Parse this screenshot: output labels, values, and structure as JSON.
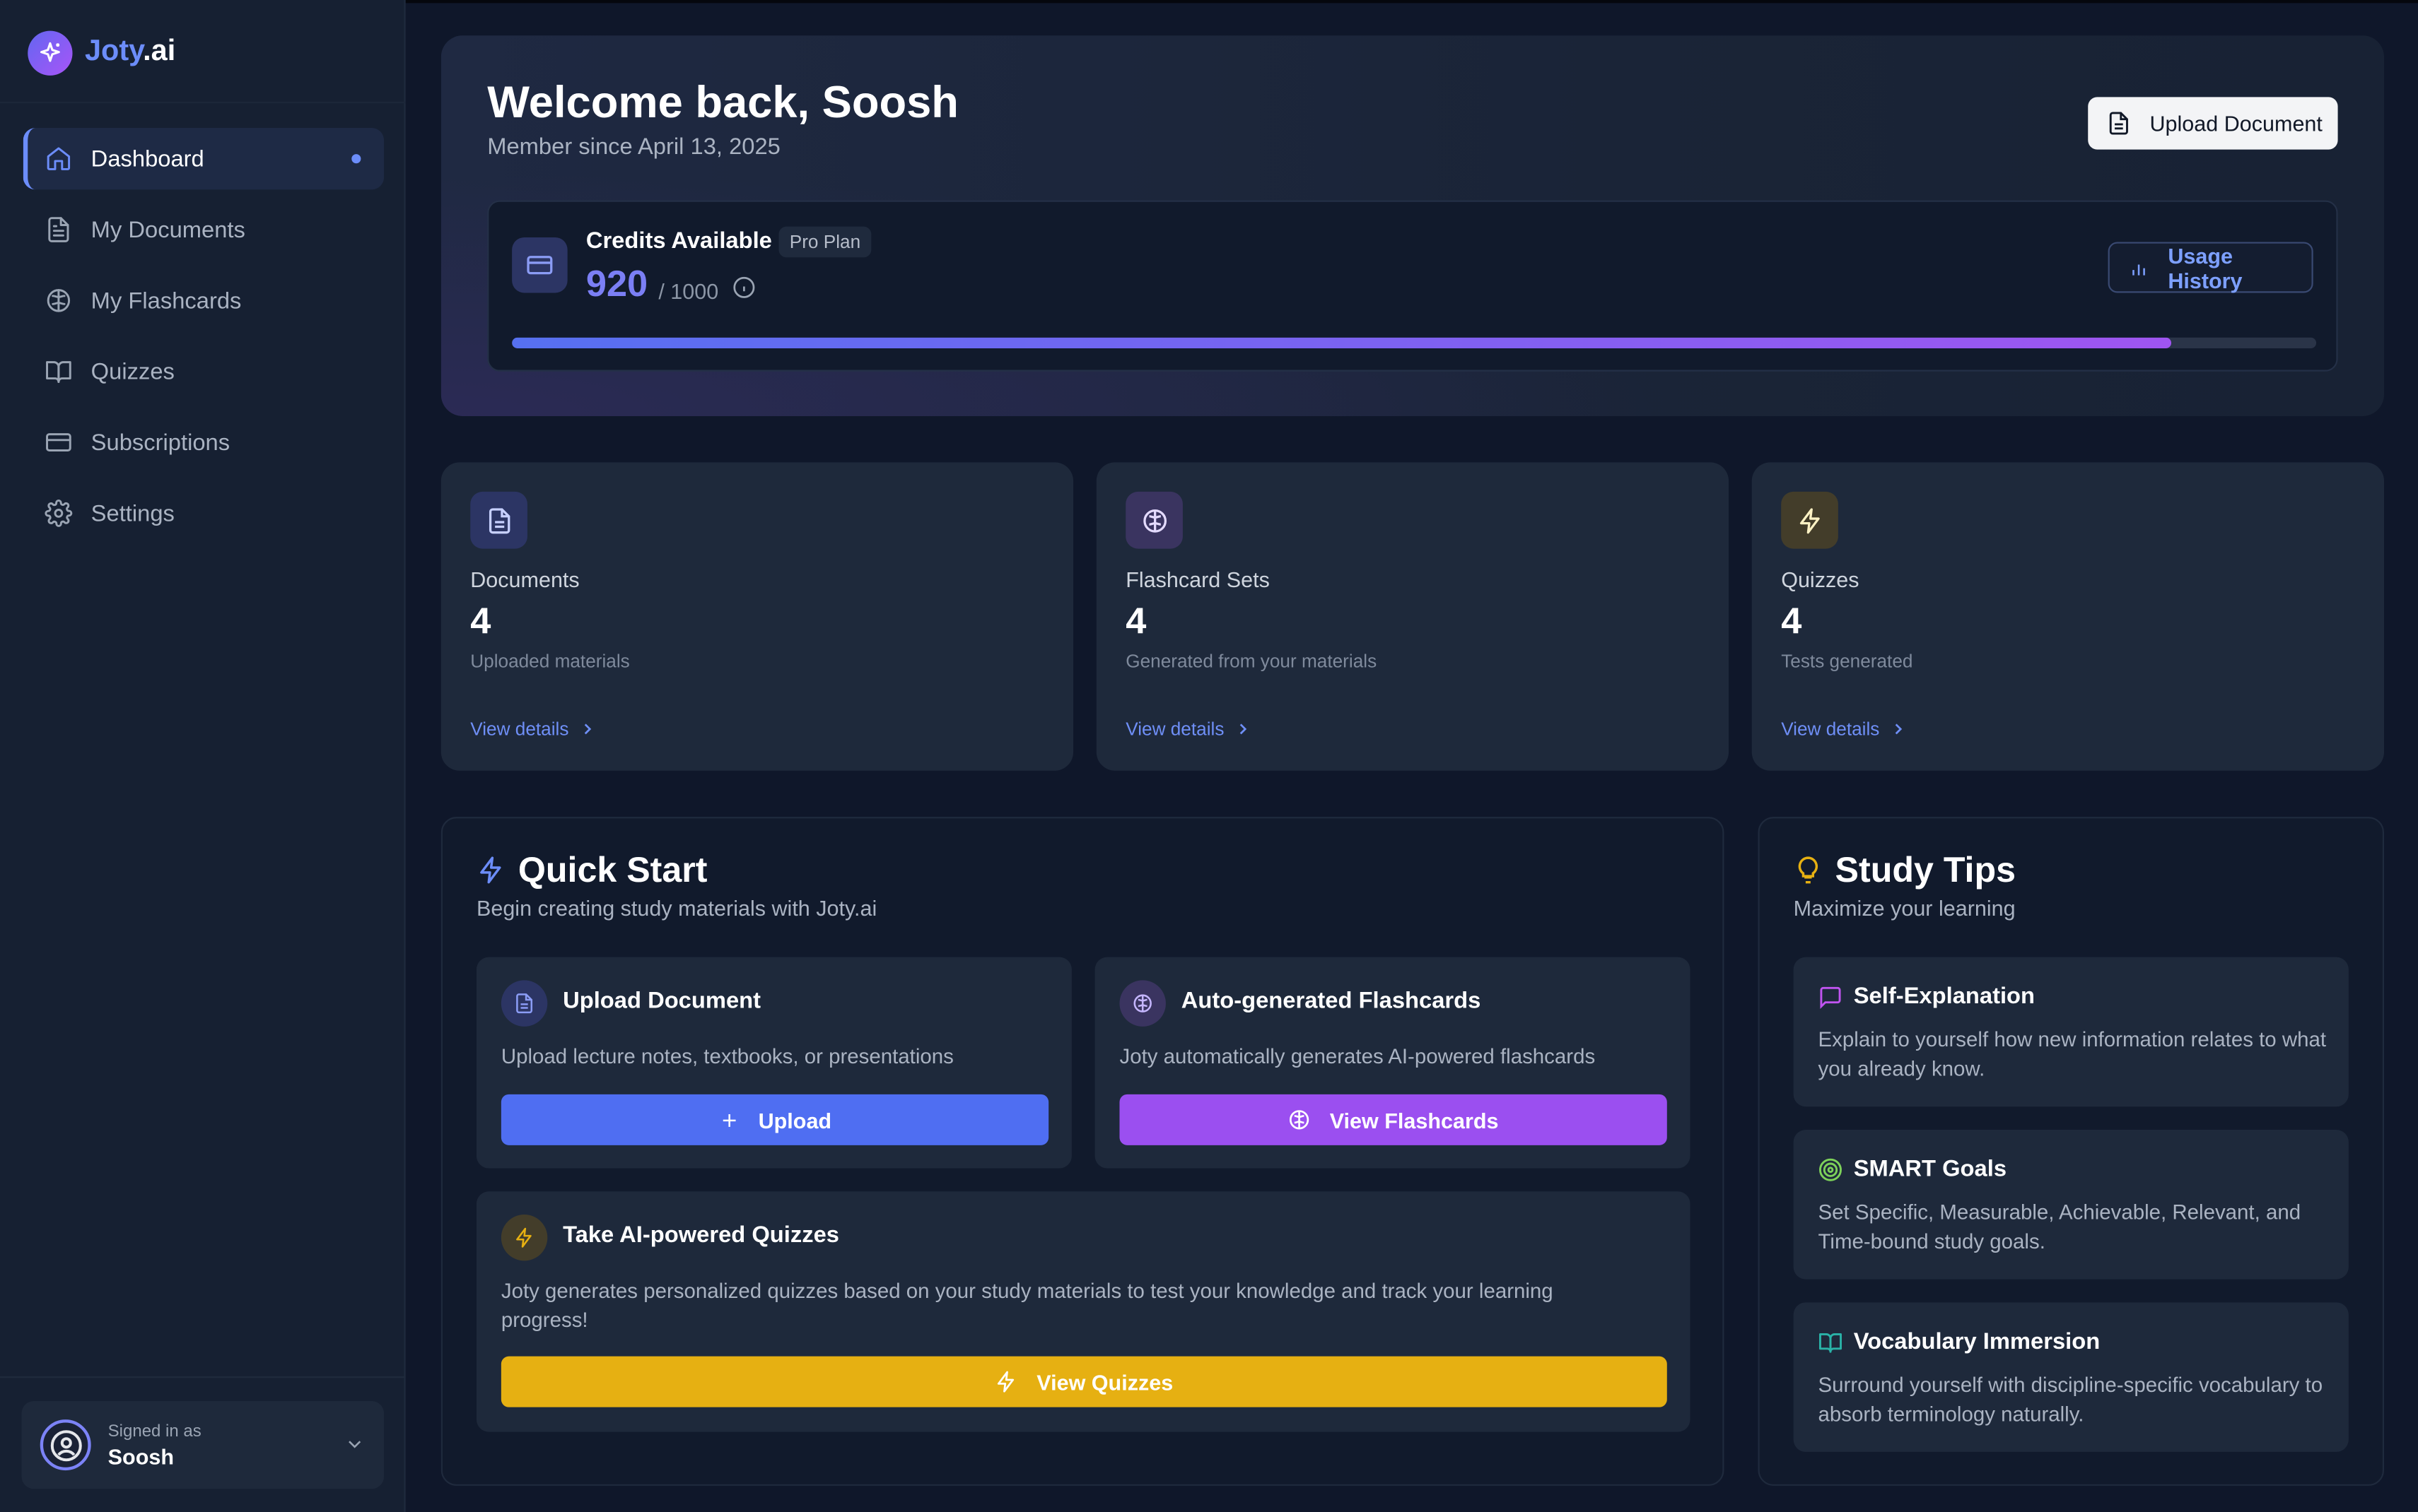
{
  "brand": {
    "name_part1": "Joty",
    "name_part2": ".ai",
    "accent_color": "#6c8dfa"
  },
  "sidebar": {
    "items": [
      {
        "label": "Dashboard",
        "icon": "home-icon",
        "active": true
      },
      {
        "label": "My Documents",
        "icon": "document-icon"
      },
      {
        "label": "My Flashcards",
        "icon": "brain-icon"
      },
      {
        "label": "Quizzes",
        "icon": "book-open-icon"
      },
      {
        "label": "Subscriptions",
        "icon": "credit-card-icon"
      },
      {
        "label": "Settings",
        "icon": "gear-icon"
      }
    ],
    "user": {
      "signed_in_label": "Signed in as",
      "name": "Soosh"
    }
  },
  "welcome": {
    "title": "Welcome back, Soosh",
    "member_since": "Member since April 13, 2025",
    "upload_button": "Upload Document"
  },
  "credits": {
    "title": "Credits Available",
    "plan": "Pro Plan",
    "available": "920",
    "total_text": "/ 1000",
    "used_fraction": 0.92,
    "usage_button": "Usage History"
  },
  "stats": [
    {
      "label": "Documents",
      "value": "4",
      "desc": "Uploaded materials",
      "link": "View details",
      "icon": "document-icon",
      "color": "#8b9cf5"
    },
    {
      "label": "Flashcard Sets",
      "value": "4",
      "desc": "Generated from your materials",
      "link": "View details",
      "icon": "brain-icon",
      "color": "#c4b5fd"
    },
    {
      "label": "Quizzes",
      "value": "4",
      "desc": "Tests generated",
      "link": "View details",
      "icon": "lightning-icon",
      "color": "#fde68a"
    }
  ],
  "quick_start": {
    "title": "Quick Start",
    "subtitle": "Begin creating study materials with Joty.ai",
    "upload": {
      "title": "Upload Document",
      "desc": "Upload lecture notes, textbooks, or presentations",
      "button": "Upload",
      "color": "#4f6ef2"
    },
    "flashcards": {
      "title": "Auto-generated Flashcards",
      "desc": "Joty automatically generates AI-powered flashcards",
      "button": "View Flashcards",
      "color": "#9b4ff0"
    },
    "quizzes": {
      "title": "Take AI-powered Quizzes",
      "desc": "Joty generates personalized quizzes based on your study materials to test your knowledge and track your learning progress!",
      "button": "View Quizzes",
      "color": "#e6b012"
    }
  },
  "study_tips": {
    "title": "Study Tips",
    "subtitle": "Maximize your learning",
    "tips": [
      {
        "title": "Self-Explanation",
        "desc": "Explain to yourself how new information relates to what you already know.",
        "icon": "message-icon",
        "color": "#c054f0"
      },
      {
        "title": "SMART Goals",
        "desc": "Set Specific, Measurable, Achievable, Relevant, and Time-bound study goals.",
        "icon": "target-icon",
        "color": "#7dd15a"
      },
      {
        "title": "Vocabulary Immersion",
        "desc": "Surround yourself with discipline-specific vocabulary to absorb terminology naturally.",
        "icon": "book-open-icon",
        "color": "#2ab3a8"
      }
    ]
  }
}
